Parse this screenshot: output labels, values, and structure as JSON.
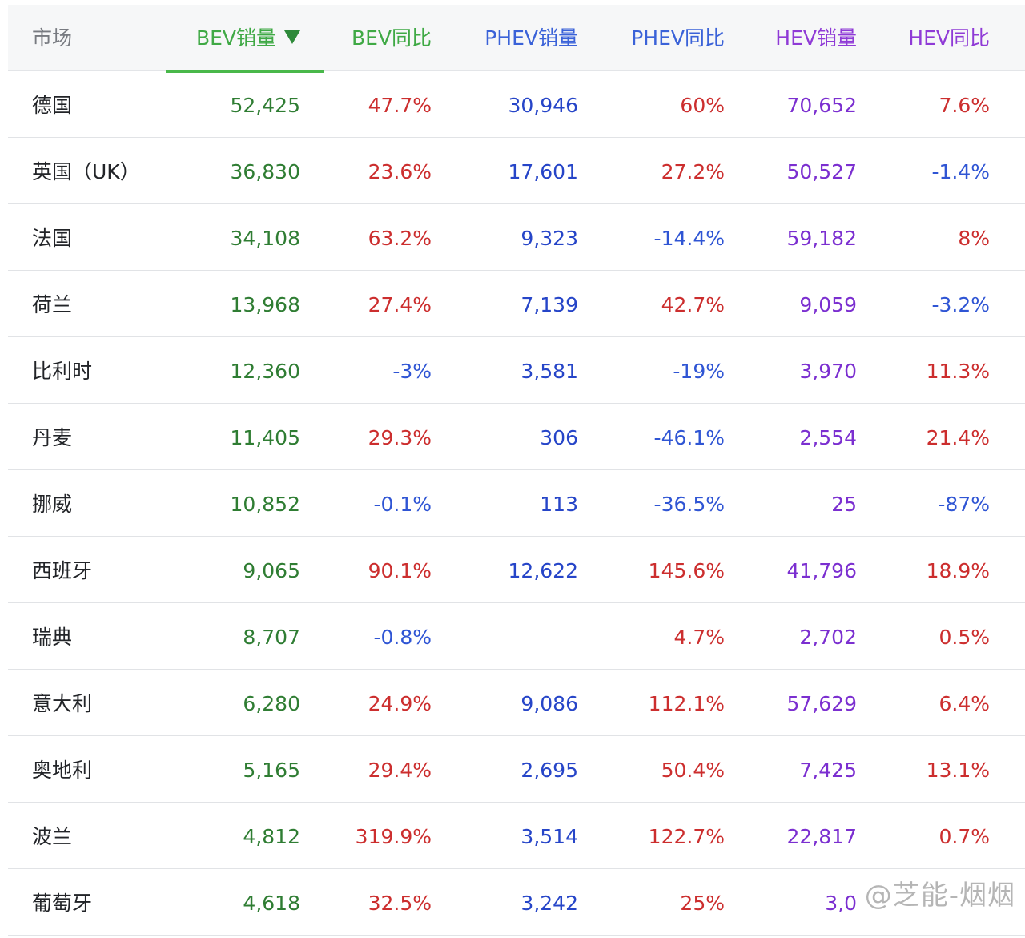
{
  "headers": {
    "market": "市场",
    "bev_sales": "BEV销量",
    "bev_yoy": "BEV同比",
    "phev_sales": "PHEV销量",
    "phev_yoy": "PHEV同比",
    "hev_sales": "HEV销量",
    "hev_yoy": "HEV同比",
    "sort_icon": "triangle-down-icon"
  },
  "colors": {
    "bev": "#2f7d33",
    "phev": "#2645c8",
    "hev": "#7b2fd0",
    "positive": "#cc2e2e",
    "negative": "#2f55d4",
    "sort_underline": "#49b84a"
  },
  "rows": [
    {
      "market": "德国",
      "bev_sales": "52,425",
      "bev_yoy": "47.7%",
      "phev_sales": "30,946",
      "phev_yoy": "60%",
      "hev_sales": "70,652",
      "hev_yoy": "7.6%"
    },
    {
      "market": "英国（UK）",
      "bev_sales": "36,830",
      "bev_yoy": "23.6%",
      "phev_sales": "17,601",
      "phev_yoy": "27.2%",
      "hev_sales": "50,527",
      "hev_yoy": "-1.4%"
    },
    {
      "market": "法国",
      "bev_sales": "34,108",
      "bev_yoy": "63.2%",
      "phev_sales": "9,323",
      "phev_yoy": "-14.4%",
      "hev_sales": "59,182",
      "hev_yoy": "8%"
    },
    {
      "market": "荷兰",
      "bev_sales": "13,968",
      "bev_yoy": "27.4%",
      "phev_sales": "7,139",
      "phev_yoy": "42.7%",
      "hev_sales": "9,059",
      "hev_yoy": "-3.2%"
    },
    {
      "market": "比利时",
      "bev_sales": "12,360",
      "bev_yoy": "-3%",
      "phev_sales": "3,581",
      "phev_yoy": "-19%",
      "hev_sales": "3,970",
      "hev_yoy": "11.3%"
    },
    {
      "market": "丹麦",
      "bev_sales": "11,405",
      "bev_yoy": "29.3%",
      "phev_sales": "306",
      "phev_yoy": "-46.1%",
      "hev_sales": "2,554",
      "hev_yoy": "21.4%"
    },
    {
      "market": "挪威",
      "bev_sales": "10,852",
      "bev_yoy": "-0.1%",
      "phev_sales": "113",
      "phev_yoy": "-36.5%",
      "hev_sales": "25",
      "hev_yoy": "-87%"
    },
    {
      "market": "西班牙",
      "bev_sales": "9,065",
      "bev_yoy": "90.1%",
      "phev_sales": "12,622",
      "phev_yoy": "145.6%",
      "hev_sales": "41,796",
      "hev_yoy": "18.9%"
    },
    {
      "market": "瑞典",
      "bev_sales": "8,707",
      "bev_yoy": "-0.8%",
      "phev_sales": "",
      "phev_yoy": "4.7%",
      "hev_sales": "2,702",
      "hev_yoy": "0.5%"
    },
    {
      "market": "意大利",
      "bev_sales": "6,280",
      "bev_yoy": "24.9%",
      "phev_sales": "9,086",
      "phev_yoy": "112.1%",
      "hev_sales": "57,629",
      "hev_yoy": "6.4%"
    },
    {
      "market": "奥地利",
      "bev_sales": "5,165",
      "bev_yoy": "29.4%",
      "phev_sales": "2,695",
      "phev_yoy": "50.4%",
      "hev_sales": "7,425",
      "hev_yoy": "13.1%"
    },
    {
      "market": "波兰",
      "bev_sales": "4,812",
      "bev_yoy": "319.9%",
      "phev_sales": "3,514",
      "phev_yoy": "122.7%",
      "hev_sales": "22,817",
      "hev_yoy": "0.7%"
    },
    {
      "market": "葡萄牙",
      "bev_sales": "4,618",
      "bev_yoy": "32.5%",
      "phev_sales": "3,242",
      "phev_yoy": "25%",
      "hev_sales": "3,0",
      "hev_yoy": ""
    }
  ],
  "watermark": "@芝能-烟烟"
}
